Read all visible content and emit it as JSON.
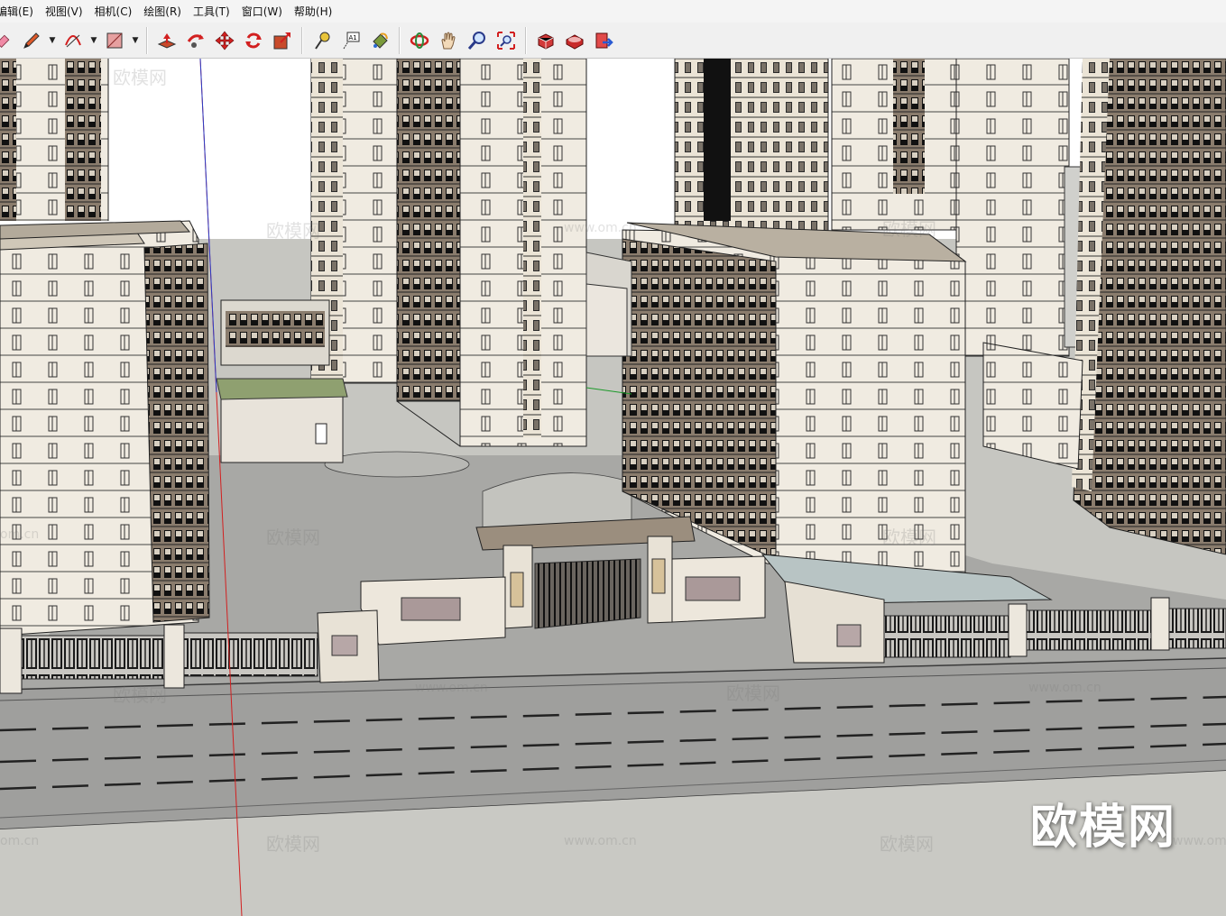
{
  "menu": [
    {
      "label": "编辑(E)"
    },
    {
      "label": "视图(V)"
    },
    {
      "label": "相机(C)"
    },
    {
      "label": "绘图(R)"
    },
    {
      "label": "工具(T)"
    },
    {
      "label": "窗口(W)"
    },
    {
      "label": "帮助(H)"
    }
  ],
  "toolbar": {
    "tools": [
      "eraser-icon",
      "pencil-icon",
      "arc-icon",
      "rectangle-icon",
      "push-pull-icon",
      "follow-me-icon",
      "move-icon",
      "rotate-icon",
      "scale-icon",
      "tape-measure-icon",
      "text-icon",
      "paint-bucket-icon",
      "orbit-icon",
      "pan-icon",
      "zoom-icon",
      "zoom-extents-icon",
      "component-icon",
      "warehouse-icon",
      "export-icon"
    ],
    "text_tool_label": "A1"
  },
  "watermarks": {
    "brand": "欧模网",
    "site": "www.om.cn",
    "site_partial": "om.cn"
  },
  "colors": {
    "sky": "#ffffff",
    "ground": "#c4c4bf",
    "road": "#9c9c9c",
    "plaza": "#a9a9a6",
    "building_light": "#ece6db",
    "building_dark": "#8d7f71",
    "red_axis": "#d22020",
    "blue_axis": "#2a3cc8",
    "green_axis": "#1c9a2a"
  }
}
